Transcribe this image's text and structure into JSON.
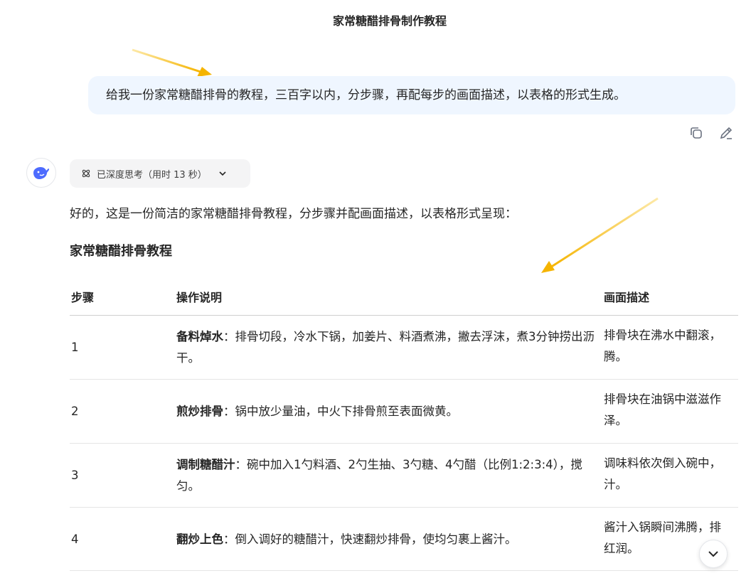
{
  "chat": {
    "title": "家常糖醋排骨制作教程"
  },
  "user_message": {
    "text": "给我一份家常糖醋排骨的教程，三百字以内，分步骤，再配每步的画面描述，以表格的形式生成。"
  },
  "message_actions": {
    "copy_icon": "copy-icon",
    "edit_icon": "edit-icon"
  },
  "assistant": {
    "avatar_icon": "deepseek-whale-icon",
    "thinking": {
      "label": "已深度思考（用时 13 秒）",
      "icon": "atom-icon",
      "toggle_icon": "chevron-down-icon"
    },
    "intro": "好的，这是一份简洁的家常糖醋排骨教程，分步骤并配画面描述，以表格形式呈现：",
    "section_heading": "家常糖醋排骨教程",
    "table": {
      "headers": [
        "步骤",
        "操作说明",
        "画面描述"
      ],
      "rows": [
        {
          "step": "1",
          "op_name": "备料焯水",
          "op_text": "：排骨切段，冷水下锅，加姜片、料酒煮沸，撇去浮沫，煮3分钟捞出沥干。",
          "desc_line1": "排骨块在沸水中翻滚，",
          "desc_line2": "腾。"
        },
        {
          "step": "2",
          "op_name": "煎炒排骨",
          "op_text": "：锅中放少量油，中火下排骨煎至表面微黄。",
          "desc_line1": "排骨块在油锅中滋滋作",
          "desc_line2": "泽。"
        },
        {
          "step": "3",
          "op_name": "调制糖醋汁",
          "op_text": "：碗中加入1勺料酒、2勺生抽、3勺糖、4勺醋（比例1:2:3:4），搅匀。",
          "desc_line1": "调味料依次倒入碗中，",
          "desc_line2": "汁。"
        },
        {
          "step": "4",
          "op_name": "翻炒上色",
          "op_text": "：倒入调好的糖醋汁，快速翻炒排骨，使均匀裹上酱汁。",
          "desc_line1": "酱汁入锅瞬间沸腾，排",
          "desc_line2": "红润。"
        }
      ]
    }
  },
  "scroll_button": {
    "icon": "chevron-down-icon"
  },
  "colors": {
    "user_bubble": "#eff6ff",
    "accent_blue": "#4d6bfe",
    "annotation_arrow": "#f5b400"
  }
}
